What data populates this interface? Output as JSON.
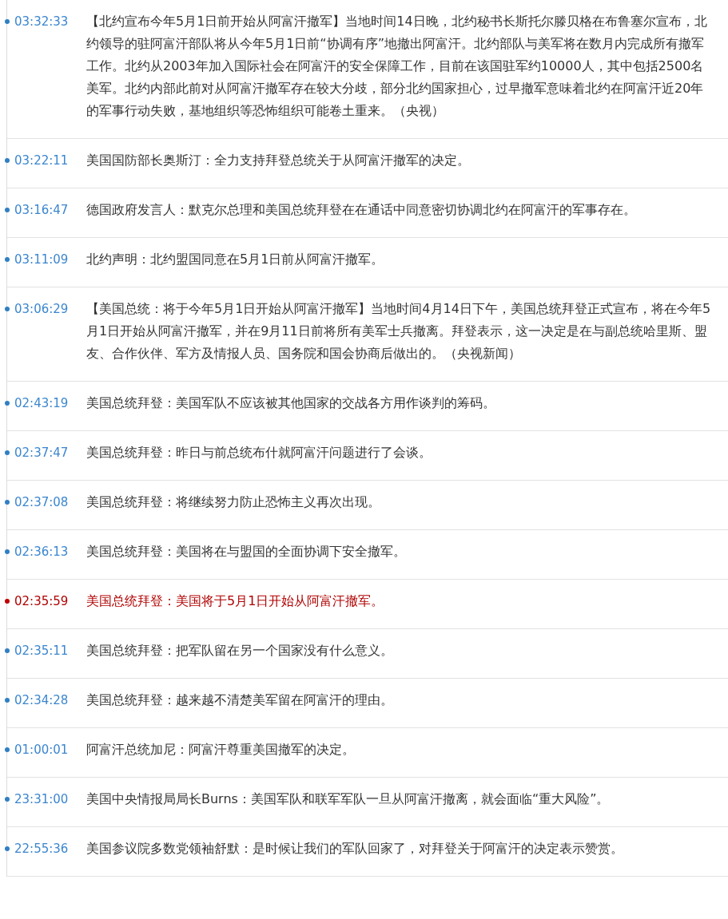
{
  "items": [
    {
      "time": "03:32:33",
      "text": "【北约宣布今年5月1日前开始从阿富汗撤军】当地时间14日晚，北约秘书长斯托尔滕贝格在布鲁塞尔宣布，北约领导的驻阿富汗部队将从今年5月1日前“协调有序”地撤出阿富汗。北约部队与美军将在数月内完成所有撤军工作。北约从2003年加入国际社会在阿富汗的安全保障工作，目前在该国驻军约10000人，其中包括2500名美军。北约内部此前对从阿富汗撤军存在较大分歧，部分北约国家担心，过早撤军意味着北约在阿富汗近20年的军事行动失败，基地组织等恐怖组织可能卷土重来。（央视）",
      "important": false
    },
    {
      "time": "03:22:11",
      "text": "美国国防部长奥斯汀：全力支持拜登总统关于从阿富汗撤军的决定。",
      "important": false
    },
    {
      "time": "03:16:47",
      "text": "德国政府发言人：默克尔总理和美国总统拜登在在通话中同意密切协调北约在阿富汗的军事存在。",
      "important": false
    },
    {
      "time": "03:11:09",
      "text": "北约声明：北约盟国同意在5月1日前从阿富汗撤军。",
      "important": false
    },
    {
      "time": "03:06:29",
      "text": "【美国总统：将于今年5月1日开始从阿富汗撤军】当地时间4月14日下午，美国总统拜登正式宣布，将在今年5月1日开始从阿富汗撤军，并在9月11日前将所有美军士兵撤离。拜登表示，这一决定是在与副总统哈里斯、盟友、合作伙伴、军方及情报人员、国务院和国会协商后做出的。（央视新闻）",
      "important": false
    },
    {
      "time": "02:43:19",
      "text": "美国总统拜登：美国军队不应该被其他国家的交战各方用作谈判的筹码。",
      "important": false
    },
    {
      "time": "02:37:47",
      "text": "美国总统拜登：昨日与前总统布什就阿富汗问题进行了会谈。",
      "important": false
    },
    {
      "time": "02:37:08",
      "text": "美国总统拜登：将继续努力防止恐怖主义再次出现。",
      "important": false
    },
    {
      "time": "02:36:13",
      "text": "美国总统拜登：美国将在与盟国的全面协调下安全撤军。",
      "important": false
    },
    {
      "time": "02:35:59",
      "text": "美国总统拜登：美国将于5月1日开始从阿富汗撤军。",
      "important": true
    },
    {
      "time": "02:35:11",
      "text": "美国总统拜登：把军队留在另一个国家没有什么意义。",
      "important": false
    },
    {
      "time": "02:34:28",
      "text": "美国总统拜登：越来越不清楚美军留在阿富汗的理由。",
      "important": false
    },
    {
      "time": "01:00:01",
      "text": "阿富汗总统加尼：阿富汗尊重美国撤军的决定。",
      "important": false
    },
    {
      "time": "23:31:00",
      "text": "美国中央情报局局长Burns：美国军队和联军军队一旦从阿富汗撤离，就会面临“重大风险”。",
      "important": false
    },
    {
      "time": "22:55:36",
      "text": "美国参议院多数党领袖舒默：是时候让我们的军队回家了，对拜登关于阿富汗的决定表示赞赏。",
      "important": false
    }
  ]
}
